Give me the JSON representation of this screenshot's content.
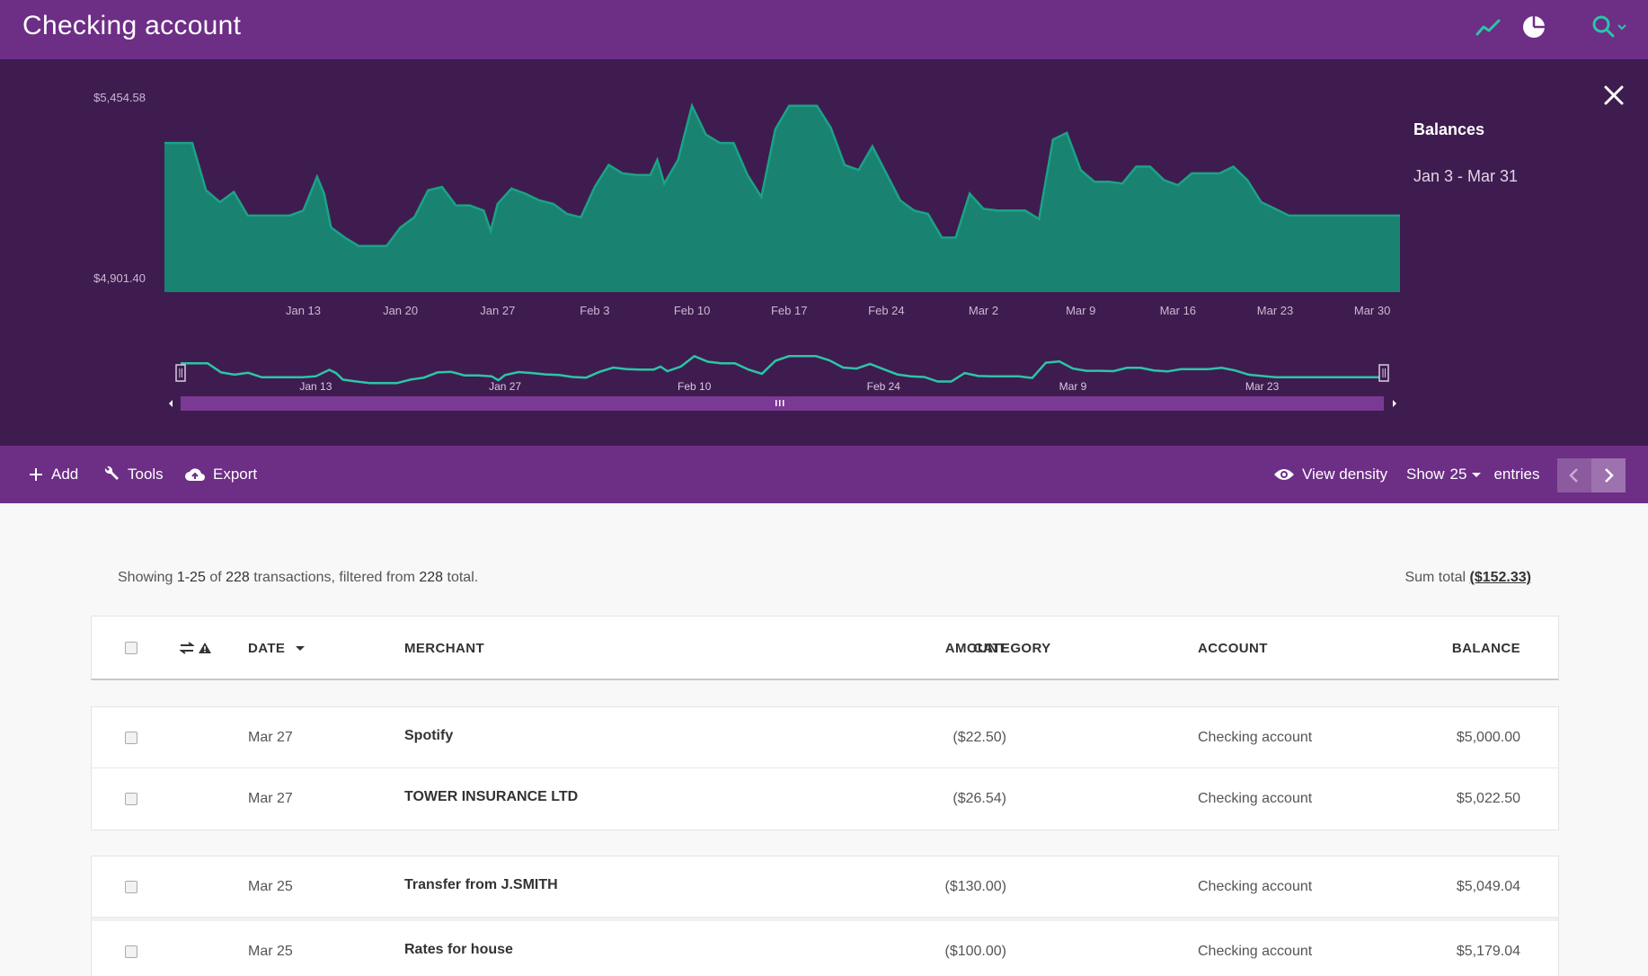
{
  "header": {
    "title": "Checking account"
  },
  "chart_panel": {
    "legend_title": "Balances",
    "legend_range": "Jan 3 - Mar 31"
  },
  "chart_data": {
    "type": "area",
    "title": "",
    "y_labels": [
      "$5,454.58",
      "$4,901.40"
    ],
    "ylim": [
      4901.4,
      5454.58
    ],
    "x_ticks": [
      "Jan 13",
      "Jan 20",
      "Jan 27",
      "Feb 3",
      "Feb 10",
      "Feb 17",
      "Feb 24",
      "Mar 2",
      "Mar 9",
      "Mar 16",
      "Mar 23",
      "Mar 30"
    ],
    "x_tick_days": [
      10,
      17,
      24,
      31,
      38,
      45,
      52,
      59,
      66,
      73,
      80,
      87
    ],
    "xlim_days": [
      0,
      89
    ],
    "series": [
      {
        "x_days": [
          0,
          2,
          3,
          4,
          5,
          6,
          7,
          8,
          9,
          10,
          11,
          11.5,
          12,
          13,
          14,
          15,
          16,
          17,
          18,
          19,
          20,
          21,
          22,
          23,
          23.5,
          24,
          25,
          26,
          27,
          28,
          29,
          30,
          31,
          32,
          33,
          34,
          35,
          35.5,
          36,
          37,
          38,
          39,
          40,
          41,
          42,
          43,
          44,
          45,
          46,
          47,
          48,
          49,
          50,
          51,
          52,
          53,
          54,
          55,
          56,
          57,
          58,
          59,
          60,
          61,
          62,
          63,
          64,
          65,
          66,
          67,
          68,
          69,
          70,
          71,
          72,
          73,
          74,
          75,
          76,
          77,
          78,
          79,
          80,
          81,
          82,
          83,
          84,
          85,
          86,
          87,
          89
        ],
        "values": [
          5340,
          5340,
          5200,
          5165,
          5195,
          5125,
          5125,
          5125,
          5125,
          5140,
          5240,
          5190,
          5090,
          5060,
          5035,
          5035,
          5035,
          5090,
          5120,
          5200,
          5210,
          5155,
          5155,
          5140,
          5080,
          5160,
          5205,
          5190,
          5170,
          5160,
          5130,
          5120,
          5210,
          5275,
          5250,
          5245,
          5245,
          5290,
          5220,
          5290,
          5450,
          5365,
          5340,
          5340,
          5245,
          5180,
          5380,
          5450,
          5450,
          5450,
          5385,
          5275,
          5260,
          5330,
          5250,
          5170,
          5140,
          5130,
          5060,
          5060,
          5190,
          5145,
          5140,
          5140,
          5140,
          5115,
          5350,
          5370,
          5260,
          5225,
          5225,
          5220,
          5270,
          5270,
          5230,
          5215,
          5250,
          5250,
          5250,
          5270,
          5230,
          5165,
          5145,
          5125,
          5125,
          5125,
          5125,
          5125,
          5125,
          5125,
          5125
        ]
      }
    ],
    "navigator_ticks": [
      "Jan 13",
      "Jan 27",
      "Feb 10",
      "Feb 24",
      "Mar 9",
      "Mar 23"
    ]
  },
  "toolbar": {
    "add": "Add",
    "tools": "Tools",
    "export": "Export",
    "view_density": "View density",
    "show_prefix": "Show",
    "show_count": "25",
    "show_suffix": "entries"
  },
  "summary": {
    "prefix": "Showing",
    "range": "1-25",
    "of": "of",
    "count": "228",
    "mid": "transactions, filtered from",
    "total": "228",
    "suffix": "total.",
    "sum_label": "Sum total",
    "sum_value": "($152.33)"
  },
  "table": {
    "headers": {
      "date": "DATE",
      "merchant": "MERCHANT",
      "amount": "AMOUNT",
      "category": "CATEGORY",
      "account": "ACCOUNT",
      "balance": "BALANCE"
    },
    "rows": [
      {
        "date": "Mar 27",
        "merchant": "Spotify",
        "amount": "($22.50)",
        "category": "",
        "account": "Checking account",
        "balance": "$5,000.00"
      },
      {
        "date": "Mar 27",
        "merchant": "TOWER INSURANCE LTD",
        "amount": "($26.54)",
        "category": "",
        "account": "Checking account",
        "balance": "$5,022.50"
      },
      {
        "date": "Mar 25",
        "merchant": "Transfer from J.SMITH",
        "amount": "($130.00)",
        "category": "",
        "account": "Checking account",
        "balance": "$5,049.04"
      },
      {
        "date": "Mar 25",
        "merchant": "Rates for house",
        "amount": "($100.00)",
        "category": "",
        "account": "Checking account",
        "balance": "$5,179.04"
      }
    ]
  },
  "colors": {
    "header_bg": "#6d2e86",
    "chart_bg": "#3f1c4f",
    "area_fill": "#1a8271",
    "area_line": "#1aa386",
    "accent": "#2cc5a6"
  },
  "icons": [
    "trend-icon",
    "pie-chart-icon",
    "search-icon",
    "close-icon",
    "plus-icon",
    "wrench-icon",
    "cloud-upload-icon",
    "eye-icon",
    "chevron-left-icon",
    "chevron-right-icon",
    "transfer-icon",
    "warning-icon"
  ]
}
